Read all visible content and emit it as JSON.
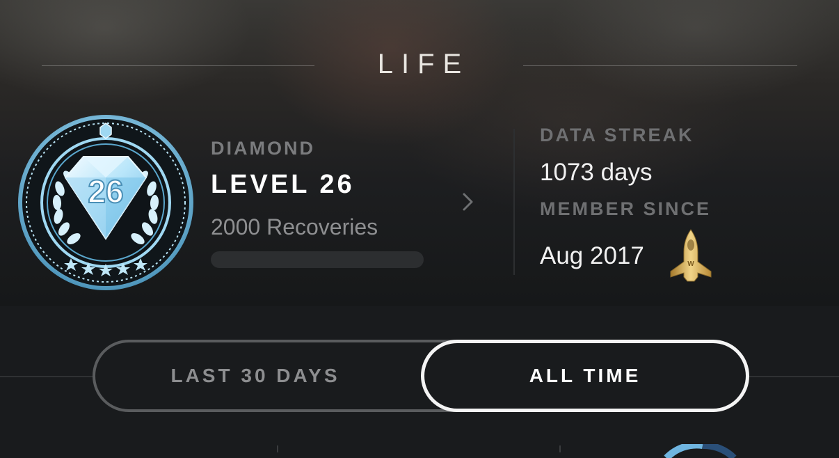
{
  "header": {
    "title": "LIFE"
  },
  "badge": {
    "number": "26"
  },
  "level": {
    "tier": "DIAMOND",
    "label": "LEVEL 26",
    "recoveries": "2000 Recoveries",
    "progress_fraction": 0.0
  },
  "stats": {
    "streak_label": "DATA STREAK",
    "streak_value": "1073 days",
    "member_label": "MEMBER SINCE",
    "member_value": "Aug 2017"
  },
  "segment": {
    "options": [
      "LAST 30 DAYS",
      "ALL TIME"
    ],
    "selected": "ALL TIME"
  },
  "colors": {
    "background": "#191b1d",
    "badge_blue": "#8fd3f0",
    "rocket_gold": "#d9b45a"
  },
  "icons": {
    "chevron": "chevron-right-icon",
    "rocket": "rocket-icon",
    "badge": "diamond-level-badge-icon"
  }
}
